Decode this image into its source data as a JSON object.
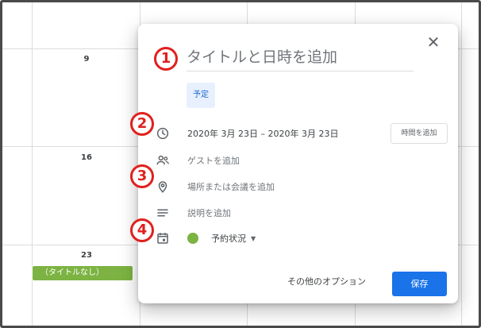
{
  "calendar": {
    "day_numbers": [
      "9",
      "16",
      "23"
    ],
    "event_chip": {
      "label": "（タイトルなし）",
      "color": "#7cb342"
    }
  },
  "dialog": {
    "close_glyph": "✕",
    "title_placeholder": "タイトルと日時を追加",
    "type_chip": "予定",
    "date_range": "2020年 3月 23日  –  2020年 3月 23日",
    "add_time_button": "時間を追加",
    "guests_placeholder": "ゲストを追加",
    "location_placeholder": "場所または会議を追加",
    "description_placeholder": "説明を追加",
    "availability_label": "予約状況",
    "availability_color": "#7cb342",
    "more_options": "その他のオプション",
    "save_button": "保存",
    "accent_color": "#1a73e8"
  },
  "annotations": [
    "1",
    "2",
    "3",
    "4"
  ]
}
